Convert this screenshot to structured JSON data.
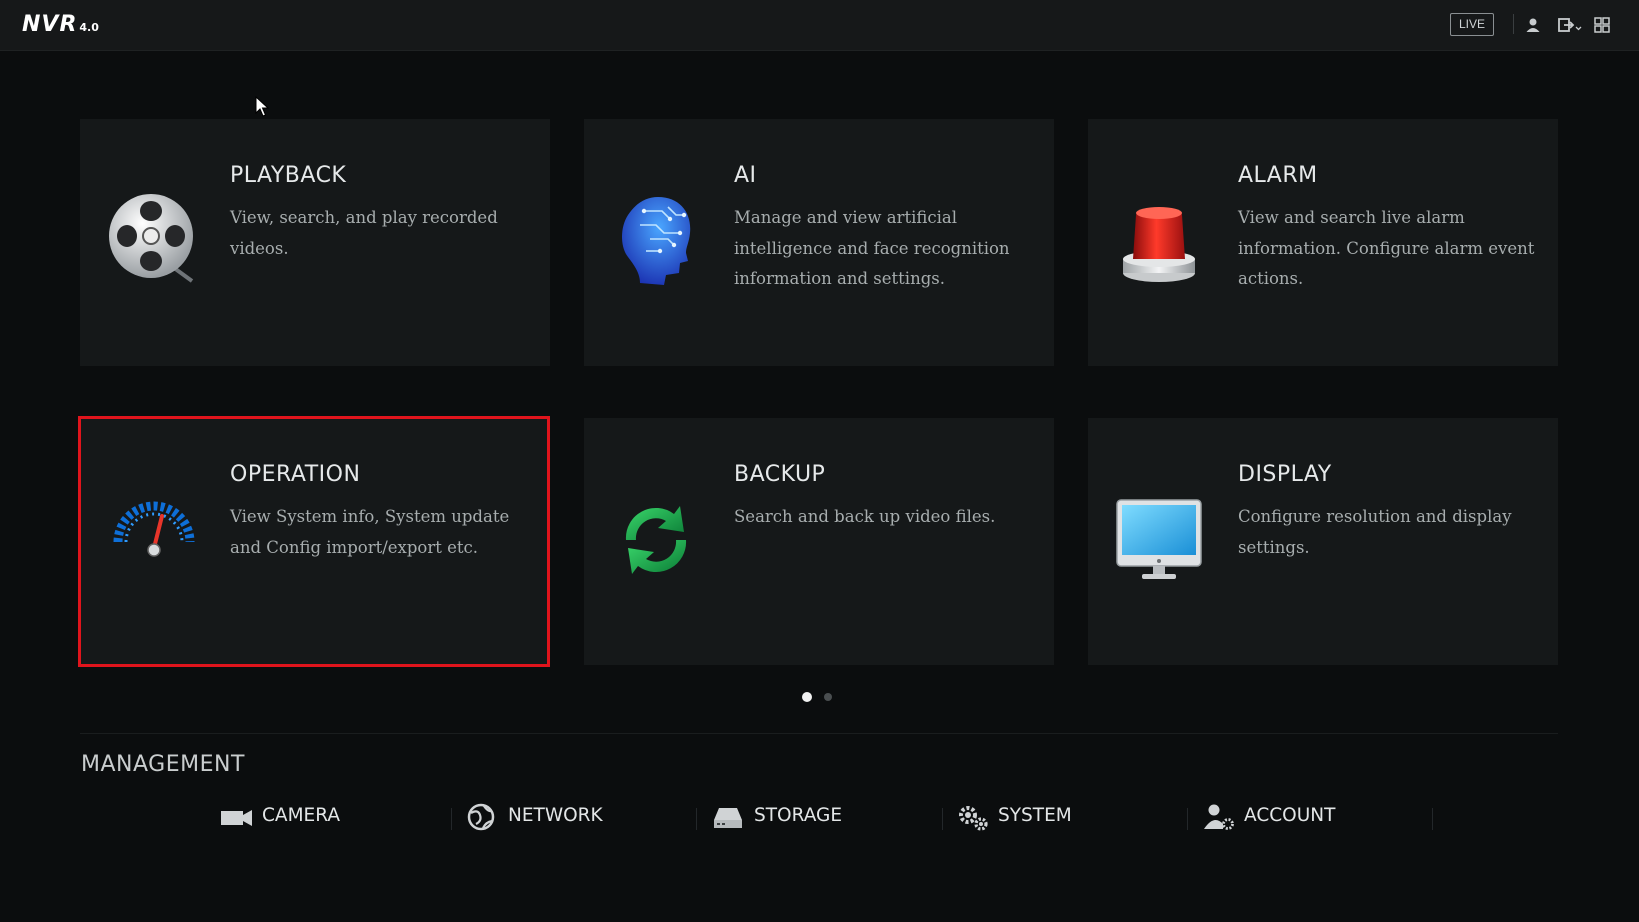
{
  "app": {
    "logo": "NVR",
    "version": "4.0"
  },
  "topbar": {
    "live_label": "LIVE",
    "icons": [
      "user-icon",
      "logout-icon",
      "grid-icon"
    ]
  },
  "cards": [
    {
      "title": "PLAYBACK",
      "description": "View, search, and play recorded videos.",
      "icon": "film-reel-icon"
    },
    {
      "title": "AI",
      "description": "Manage and view artificial intelligence and face recognition information and settings.",
      "icon": "ai-head-icon"
    },
    {
      "title": "ALARM",
      "description": "View and search live alarm information. Configure alarm event actions.",
      "icon": "alarm-light-icon"
    },
    {
      "title": "OPERATION",
      "description": "View System info, System update and Config import/export etc.",
      "icon": "gauge-icon",
      "highlighted": true
    },
    {
      "title": "BACKUP",
      "description": "Search and back up video files.",
      "icon": "refresh-icon"
    },
    {
      "title": "DISPLAY",
      "description": "Configure resolution and display settings.",
      "icon": "monitor-icon"
    }
  ],
  "pagination": {
    "current_page": 1,
    "total_pages": 2
  },
  "management": {
    "title": "MANAGEMENT",
    "items": [
      {
        "label": "CAMERA",
        "icon": "camera-icon"
      },
      {
        "label": "NETWORK",
        "icon": "globe-icon"
      },
      {
        "label": "STORAGE",
        "icon": "storage-icon"
      },
      {
        "label": "SYSTEM",
        "icon": "gears-icon"
      },
      {
        "label": "ACCOUNT",
        "icon": "account-icon"
      }
    ]
  },
  "colors": {
    "highlight": "#e0141c",
    "background": "#0b0d0e",
    "card": "#151819"
  }
}
